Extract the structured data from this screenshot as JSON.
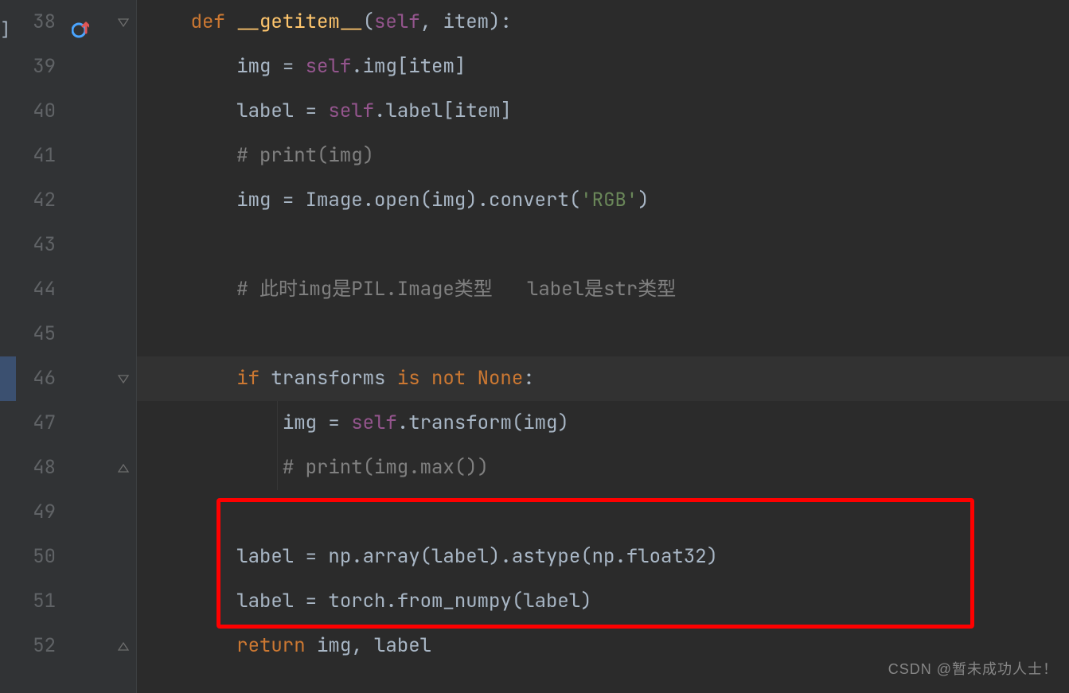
{
  "gutter": {
    "line_numbers": [
      "38",
      "39",
      "40",
      "41",
      "42",
      "43",
      "44",
      "45",
      "46",
      "47",
      "48",
      "49",
      "50",
      "51",
      "52"
    ]
  },
  "code": {
    "l38": {
      "kw_def": "def ",
      "name": "__getitem__",
      "params_open": "(",
      "self": "self",
      "comma": ", ",
      "p1": "item",
      "params_close": "):"
    },
    "l39": {
      "lhs": "img ",
      "eq": "= ",
      "self": "self",
      "dot": ".",
      "attr": "img",
      "idx": "[item]"
    },
    "l40": {
      "lhs": "label ",
      "eq": "= ",
      "self": "self",
      "dot": ".",
      "attr": "label",
      "idx": "[item]"
    },
    "l41": {
      "comment": "# print(img)"
    },
    "l42": {
      "lhs": "img ",
      "eq": "= ",
      "call1": "Image.",
      "open": "open",
      "arg1": "(img).",
      "conv": "convert",
      "paren_o": "(",
      "str": "'RGB'",
      "paren_c": ")"
    },
    "l44": {
      "comment": "# 此时img是PIL.Image类型   label是str类型"
    },
    "l46": {
      "kw_if": "if ",
      "expr": "transforms ",
      "kw_is": "is not ",
      "none": "None",
      "colon": ":"
    },
    "l47": {
      "lhs": "img ",
      "eq": "= ",
      "self": "self",
      "dot": ".",
      "attr": "transform",
      "call": "(img)"
    },
    "l48": {
      "comment": "# print(img.max())"
    },
    "l50": {
      "lhs": "label ",
      "eq": "= ",
      "np": "np.",
      "fn1": "array",
      "arg1": "(label).",
      "fn2": "astype",
      "arg2": "(np.float32)"
    },
    "l51": {
      "lhs": "label ",
      "eq": "= ",
      "torch": "torch.",
      "fn": "from_numpy",
      "arg": "(label)"
    },
    "l52": {
      "kw_return": "return ",
      "vals": "img, label"
    }
  },
  "annotation": {
    "watermark": "CSDN @暂未成功人士！"
  },
  "icons": {
    "override": "override-icon"
  },
  "red_box": {
    "top_line": 49,
    "bottom_line": 51
  }
}
